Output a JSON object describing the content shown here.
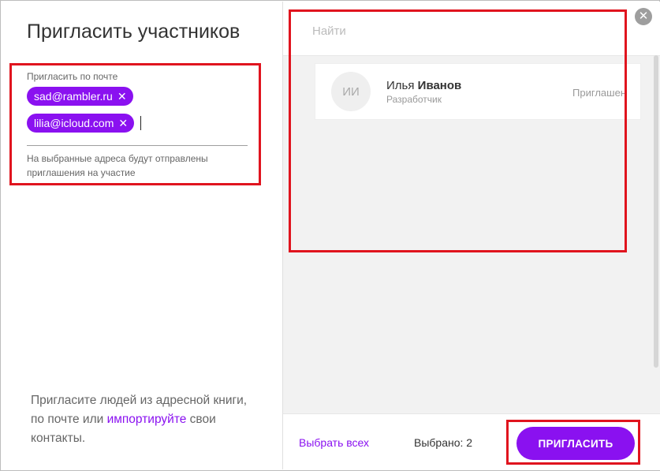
{
  "dialog": {
    "title": "Пригласить участников"
  },
  "invite": {
    "label": "Пригласить по почте",
    "emails": [
      "sad@rambler.ru",
      "lilia@icloud.com"
    ],
    "remove_symbol": "✕",
    "hint": "На выбранные адреса будут отправлены приглашения на участие"
  },
  "bottom_text": {
    "part1": "Пригласите людей из адресной книги, по почте или ",
    "link": "импортируйте",
    "part2": " свои контакты."
  },
  "search": {
    "placeholder": "Найти"
  },
  "close_symbol": "✕",
  "people": [
    {
      "initials": "ИИ",
      "first_name": "Илья",
      "last_name": "Иванов",
      "role": "Разработчик",
      "status": "Приглашен"
    }
  ],
  "footer": {
    "select_all": "Выбрать всех",
    "selected": "Выбрано: 2",
    "invite_button": "ПРИГЛАСИТЬ"
  },
  "colors": {
    "accent": "#8a11f0",
    "annotation": "#e0141e"
  }
}
